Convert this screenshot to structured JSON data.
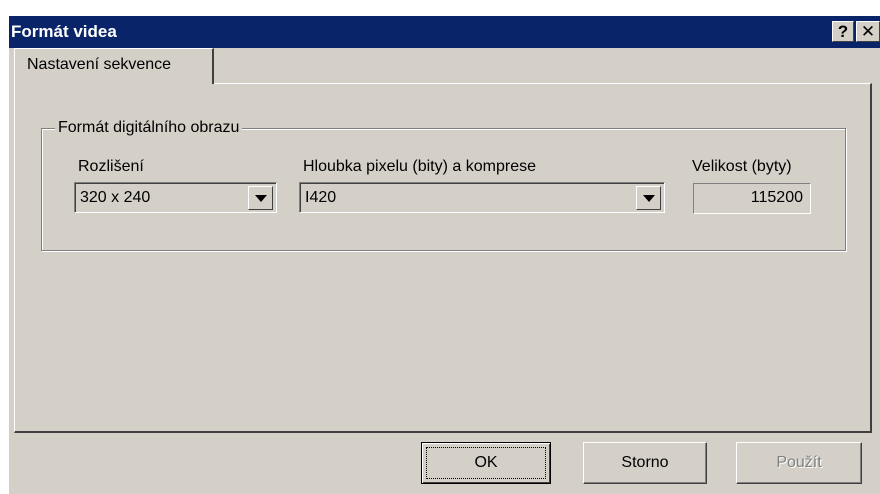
{
  "window": {
    "title": "Formát videa",
    "help_label": "?",
    "close_label": "✕"
  },
  "tabs": [
    {
      "label": "Nastavení sekvence",
      "active": true
    }
  ],
  "group": {
    "legend": "Formát digitálního obrazu",
    "resolution": {
      "label": "Rozlišení",
      "value": "320 x 240"
    },
    "pixel_depth": {
      "label": "Hloubka pixelu (bity) a komprese",
      "value": "I420"
    },
    "size": {
      "label": "Velikost (byty)",
      "value": "115200"
    }
  },
  "buttons": {
    "ok": "OK",
    "storno": "Storno",
    "apply": "Použít"
  },
  "colors": {
    "titlebar": "#0a246a",
    "face": "#d4d0c8"
  }
}
